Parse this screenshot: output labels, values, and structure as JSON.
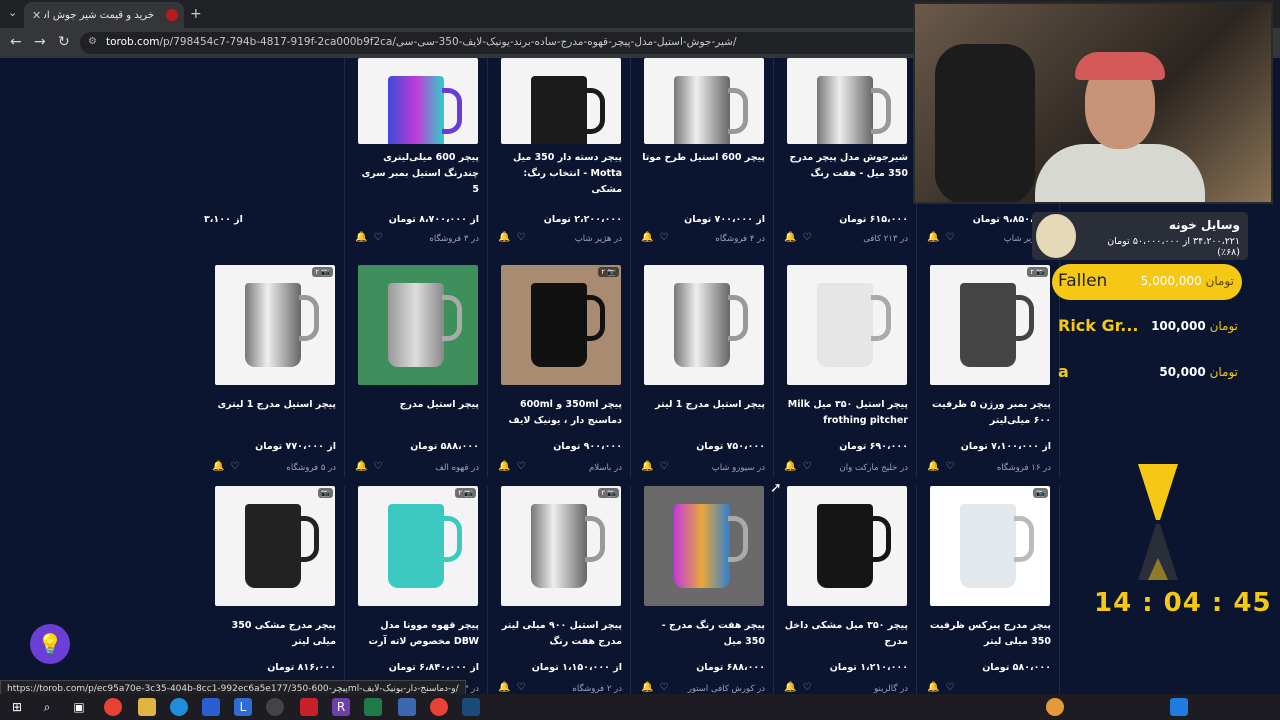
{
  "browser": {
    "tab_title": "خرید و قیمت شیر جوش استیل مد",
    "url_host": "torob.com",
    "url_path": "/p/798454c7-794b-4817-919f-2ca000b9f2ca/شیر-جوش-استیل-مدل-پیچر-قهوه-مدرج-ساده-برند-یونیک-لایف-350-سی-سی/",
    "status_url": "https://torob.com/p/ec95a70e-3c35-404b-8cc1-992ec6a5e177/350-پیچر-600ml-و-دماسنج-دار-یونیک-لایف/"
  },
  "products": [
    {
      "title": "پیچر زیرو هیرو مدل پریمیوم PREMIUM - انتخاب رنگ: استیل",
      "price": "۹،۸۵۰،۰۰۰ تومان",
      "shop": "در هژیر شاپ",
      "img": "leather"
    },
    {
      "title": "شیرجوش مدل پیچر مدرج 350 میل - هفت رنگ",
      "price": "۶۱۵،۰۰۰ تومان",
      "shop": "در ۲۱۳ کافی",
      "img": "steel"
    },
    {
      "title": "پیچر 600 استیل طرح موتا",
      "price": "از ۷۰۰،۰۰۰ تومان",
      "shop": "در ۴ فروشگاه",
      "img": "steel"
    },
    {
      "title": "پیچر دسته دار 350 میل Motta - انتخاب رنگ: مشکی",
      "price": "۲،۲۰۰،۰۰۰ تومان",
      "shop": "در هژیر شاپ",
      "img": "black"
    },
    {
      "title": "پیچر 600 میلی‌لیتری چندرنگ استیل بمبر سری 5",
      "price": "از ۸،۷۰۰،۰۰۰ تومان",
      "shop": "در ۳ فروشگاه",
      "img": "rainbow"
    },
    {
      "title": "",
      "price": "از ۳،۱۰۰",
      "shop": "",
      "img": "none"
    },
    {
      "title": "پیچر بمبر ورژن ۵ ظرفیت ۶۰۰ میلی‌لیتر",
      "price": "از ۷،۱۰۰،۰۰۰ تومان",
      "shop": "در ۱۶ فروشگاه",
      "img": "gray",
      "badge": "۲ 📷"
    },
    {
      "title": "پیچر استیل ۳۵۰ میل Milk frothing pitcher",
      "price": "۶۹۰،۰۰۰ تومان",
      "shop": "در خلیج مارکت وان",
      "img": "box"
    },
    {
      "title": "پیچر استیل مدرج 1 لیتر",
      "price": "۷۵۰،۰۰۰ تومان",
      "shop": "در سیورو شاپ",
      "img": "steel"
    },
    {
      "title": "پیچر 350ml و 600ml دماسنج دار ، یونیک لایف",
      "price": "۹۰۰،۰۰۰ تومان",
      "shop": "در باسلام",
      "img": "blackthermo",
      "badge": "۲ 📷"
    },
    {
      "title": "پیچر استیل مدرج",
      "price": "۵۸۸،۰۰۰ تومان",
      "shop": "در قهوه الف",
      "img": "green"
    },
    {
      "title": "پیچر استیل مدرج 1 لیتری",
      "price": "از ۷۷۰،۰۰۰ تومان",
      "shop": "در ۵ فروشگاه",
      "img": "steel",
      "badge": "۲ 📷"
    },
    {
      "title": "پیچر مدرج پیرکس ظرفیت 350 میلی لیتر",
      "price": "۵۸۰،۰۰۰ تومان",
      "shop": "",
      "img": "glass",
      "badge": "📷"
    },
    {
      "title": "پیچر ۳۵۰ میل مشکی داخل مدرج",
      "price": "۱،۲۱۰،۰۰۰ تومان",
      "shop": "در گالرینو",
      "img": "blackpen"
    },
    {
      "title": "پیچر هفت رنگ مدرج - 350 میل",
      "price": "۶۸۸،۰۰۰ تومان",
      "shop": "در کورش کافی استور",
      "img": "rainbowmini"
    },
    {
      "title": "پیچر استیل ۹۰۰ میلی لیتر مدرج هفت رنگ",
      "price": "از ۱،۱۵۰،۰۰۰ تومان",
      "shop": "در ۲ فروشگاه",
      "img": "steel",
      "badge": "۲ 📷"
    },
    {
      "title": "پیچر قهوه موونا مدل DBW مخصوص لاته آرت",
      "price": "از ۶،۸۴۰،۰۰۰ تومان",
      "shop": "در ۳ فروشگاه",
      "img": "teal",
      "badge": "۲ 📷"
    },
    {
      "title": "پیچر مدرج مشکی 350 میلی لیتر",
      "price": "۸۱۶،۰۰۰ تومان",
      "shop": "در قهوه بلک لیک",
      "img": "blackplain",
      "badge": "📷"
    }
  ],
  "overlay": {
    "donate_title": "وسایل خونه",
    "donate_sub": "۳۴،۲۰۰،۲۲۱ از ۵۰،۰۰۰،۰۰۰ تومان (۶۸٪)",
    "top_donor_name": "Fallen",
    "top_donor_amount": "5,000,000",
    "currency": "تومان",
    "donor2_name": "Rick Gr...",
    "donor2_amount": "100,000",
    "donor3_name": "a",
    "donor3_amount": "50,000",
    "timer": "14 : 04 : 45"
  }
}
